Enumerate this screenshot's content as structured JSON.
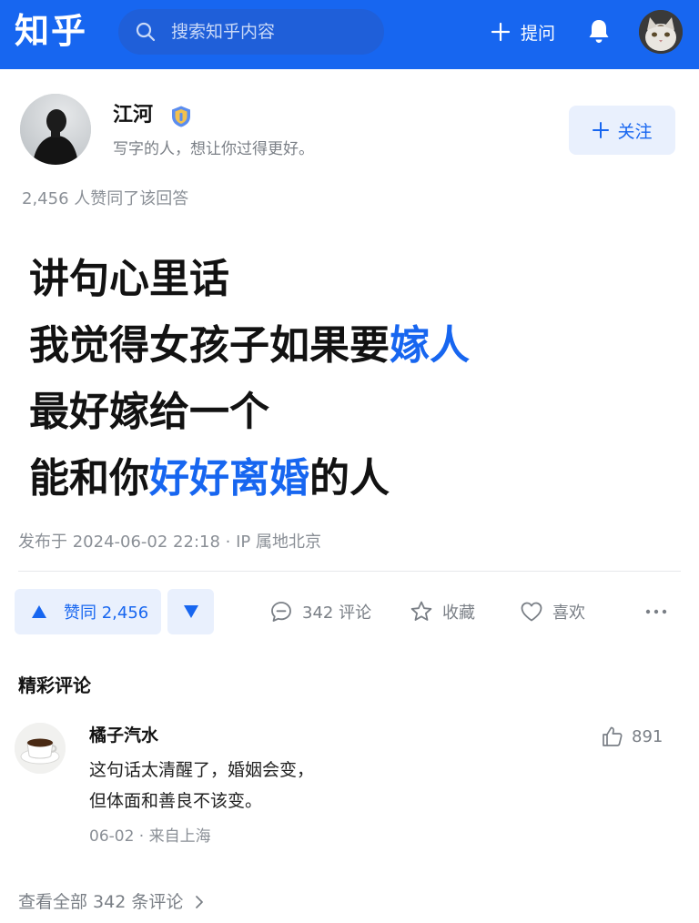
{
  "header": {
    "logo": "知乎",
    "search_placeholder": "搜索知乎内容",
    "ask_label": "提问"
  },
  "author": {
    "name": "江河",
    "bio": "写字的人，想让你过得更好。",
    "follow_label": "关注"
  },
  "agree_summary": "2,456 人赞同了该回答",
  "answer": {
    "lines": [
      [
        {
          "t": "讲句心里话",
          "hl": false
        }
      ],
      [
        {
          "t": "我觉得女孩子如果要",
          "hl": false
        },
        {
          "t": "嫁人",
          "hl": true
        }
      ],
      [
        {
          "t": "最好嫁给一个",
          "hl": false
        }
      ],
      [
        {
          "t": "能和你",
          "hl": false
        },
        {
          "t": "好好离婚",
          "hl": true
        },
        {
          "t": "的人",
          "hl": false
        }
      ]
    ]
  },
  "meta": "发布于 2024-06-02 22:18 · IP 属地北京",
  "actions": {
    "vote_up": "赞同 2,456",
    "comment": "342 评论",
    "favorite": "收藏",
    "like": "喜欢"
  },
  "comments": {
    "section_title": "精彩评论",
    "items": [
      {
        "name": "橘子汽水",
        "likes": "891",
        "text_lines": [
          "这句话太清醒了，婚姻会变，",
          "但体面和善良不该变。"
        ],
        "meta": "06-02 · 来自上海"
      }
    ],
    "view_all": "查看全部 342 条评论"
  },
  "colors": {
    "brand": "#1766f0",
    "brand_light": "#e9f0fd",
    "muted": "#8a8f96"
  },
  "icons": [
    "search-icon",
    "plus-icon",
    "bell-icon",
    "verified-badge-icon",
    "triangle-up-icon",
    "triangle-down-icon",
    "comment-icon",
    "star-icon",
    "heart-icon",
    "more-icon",
    "thumbs-up-icon",
    "chevron-right-icon"
  ]
}
